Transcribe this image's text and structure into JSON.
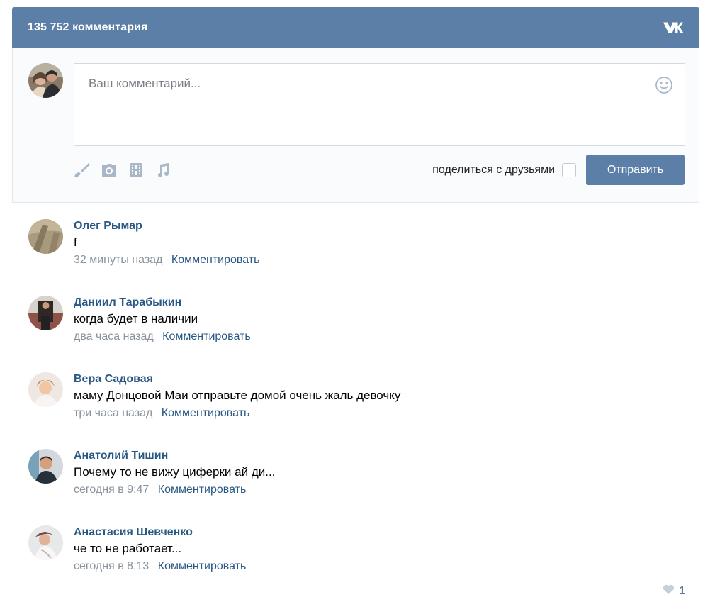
{
  "header": {
    "title": "135 752 комментария",
    "logo": "VK"
  },
  "compose": {
    "placeholder": "Ваш комментарий...",
    "share_label": "поделиться с друзьями",
    "send_label": "Отправить",
    "attach_icons": [
      "brush-icon",
      "camera-icon",
      "film-icon",
      "music-note-icon"
    ]
  },
  "comments": [
    {
      "author": "Олег Рымар",
      "text": "f",
      "time": "32 минуты назад",
      "reply": "Комментировать"
    },
    {
      "author": "Даниил Тарабыкин",
      "text": "когда будет в наличии",
      "time": "два часа назад",
      "reply": "Комментировать"
    },
    {
      "author": "Вера Садовая",
      "text": "маму Донцовой Маи отправьте домой очень жаль девочку",
      "time": "три часа назад",
      "reply": "Комментировать"
    },
    {
      "author": "Анатолий Тишин",
      "text": "Почему то не вижу циферки ай ди...",
      "time": "сегодня в 9:47",
      "reply": "Комментировать"
    },
    {
      "author": "Анастасия Шевченко",
      "text": "че то не работает...",
      "time": "сегодня в 8:13",
      "reply": "Комментировать",
      "likes": "1"
    }
  ],
  "colors": {
    "header_bg": "#5b7fa6",
    "link": "#2a5885",
    "muted": "#8a939c",
    "icon": "#a9b8c8"
  }
}
